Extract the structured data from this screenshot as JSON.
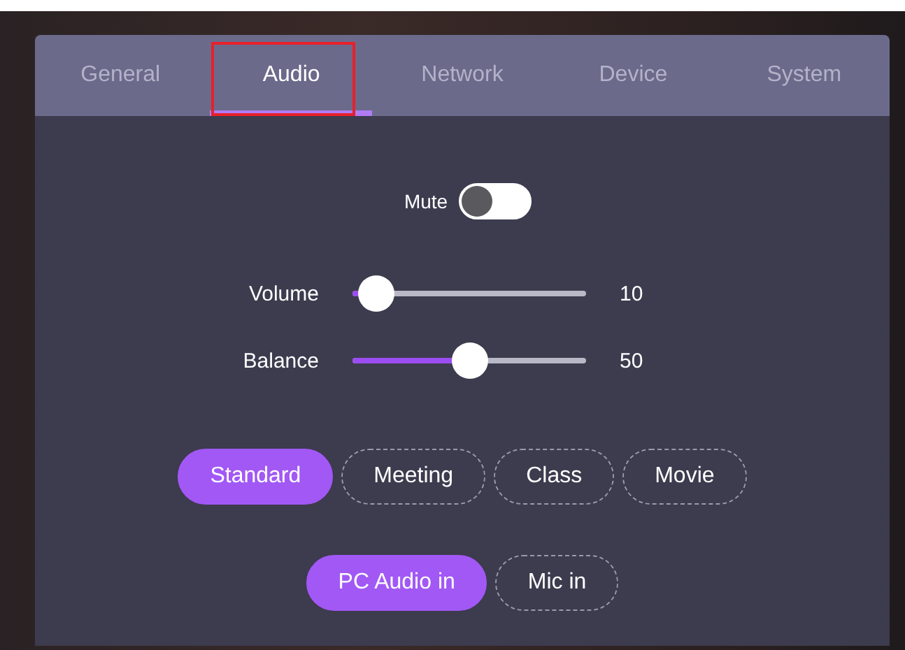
{
  "tabs": [
    {
      "label": "General",
      "selected": false,
      "annotated": false
    },
    {
      "label": "Audio",
      "selected": true,
      "annotated": true
    },
    {
      "label": "Network",
      "selected": false,
      "annotated": false
    },
    {
      "label": "Device",
      "selected": false,
      "annotated": false
    },
    {
      "label": "System",
      "selected": false,
      "annotated": false
    }
  ],
  "mute": {
    "label": "Mute",
    "on": false
  },
  "sliders": [
    {
      "label": "Volume",
      "level": 0.1,
      "reading": "10"
    },
    {
      "label": "Balance",
      "level": 0.5,
      "reading": "50"
    }
  ],
  "sound_modes": [
    {
      "label": "Standard",
      "selected": true
    },
    {
      "label": "Meeting",
      "selected": false
    },
    {
      "label": "Class",
      "selected": false
    },
    {
      "label": "Movie",
      "selected": false
    }
  ],
  "audio_sources": [
    {
      "label": "PC Audio in",
      "selected": true
    },
    {
      "label": "Mic in",
      "selected": false
    }
  ]
}
